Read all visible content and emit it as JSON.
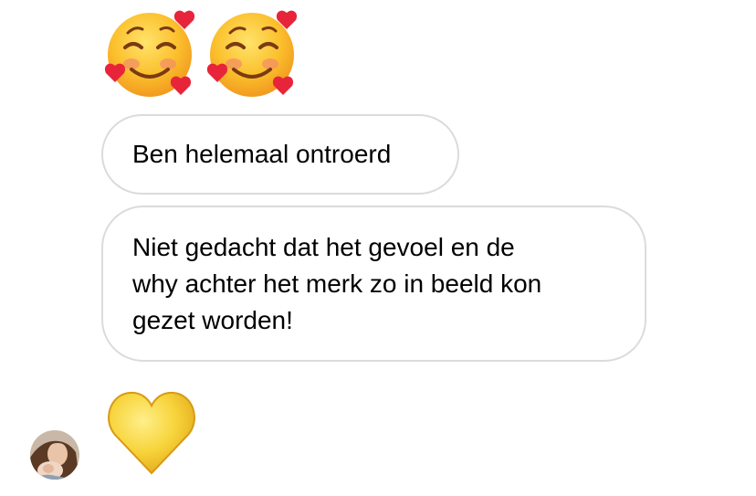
{
  "conversation": {
    "messages": [
      {
        "type": "emoji",
        "icon": "smiling-face-with-hearts-icon",
        "count": 2
      },
      {
        "type": "text",
        "text": "Ben helemaal ontroerd"
      },
      {
        "type": "text",
        "lines": [
          "Niet gedacht dat het gevoel en de",
          "why achter het merk zo in beeld kon",
          "gezet worden!"
        ]
      },
      {
        "type": "emoji",
        "icon": "yellow-heart-icon",
        "count": 1
      }
    ],
    "sender": {
      "avatar_icon": "sender-avatar"
    }
  },
  "colors": {
    "bubble_border": "#dbdbdb",
    "bubble_background": "#ffffff",
    "text": "#000000",
    "emoji_face": "#f9b233",
    "emoji_heart_red": "#e8243b",
    "heart_yellow": "#f7d43b"
  }
}
